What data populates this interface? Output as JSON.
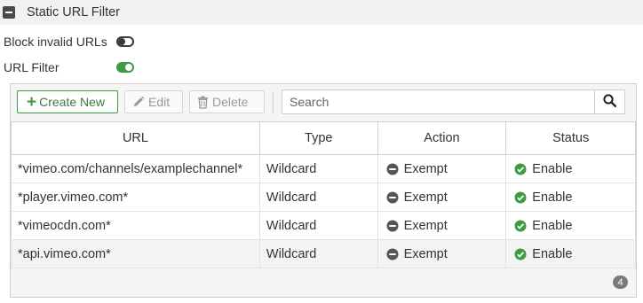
{
  "section": {
    "title": "Static URL Filter"
  },
  "settings": {
    "block_invalid_urls": {
      "label": "Block invalid URLs",
      "enabled": false
    },
    "url_filter": {
      "label": "URL Filter",
      "enabled": true
    }
  },
  "toolbar": {
    "create_label": "Create New",
    "edit_label": "Edit",
    "delete_label": "Delete",
    "search_placeholder": "Search"
  },
  "table": {
    "headers": {
      "url": "URL",
      "type": "Type",
      "action": "Action",
      "status": "Status"
    },
    "rows": [
      {
        "url": "*vimeo.com/channels/examplechannel*",
        "type": "Wildcard",
        "action": "Exempt",
        "status": "Enable"
      },
      {
        "url": "*player.vimeo.com*",
        "type": "Wildcard",
        "action": "Exempt",
        "status": "Enable"
      },
      {
        "url": "*vimeocdn.com*",
        "type": "Wildcard",
        "action": "Exempt",
        "status": "Enable"
      },
      {
        "url": "*api.vimeo.com*",
        "type": "Wildcard",
        "action": "Exempt",
        "status": "Enable"
      }
    ]
  },
  "footer": {
    "count": "4"
  },
  "colors": {
    "accent_green": "#3d9c41",
    "exempt_gray": "#555555",
    "badge_gray": "#7a7a7a"
  },
  "icons": {
    "collapse": "minus-square-icon",
    "create": "plus-icon",
    "edit": "pencil-icon",
    "delete": "trash-icon",
    "search": "search-icon",
    "exempt": "minus-circle-icon",
    "enable": "check-circle-icon"
  }
}
